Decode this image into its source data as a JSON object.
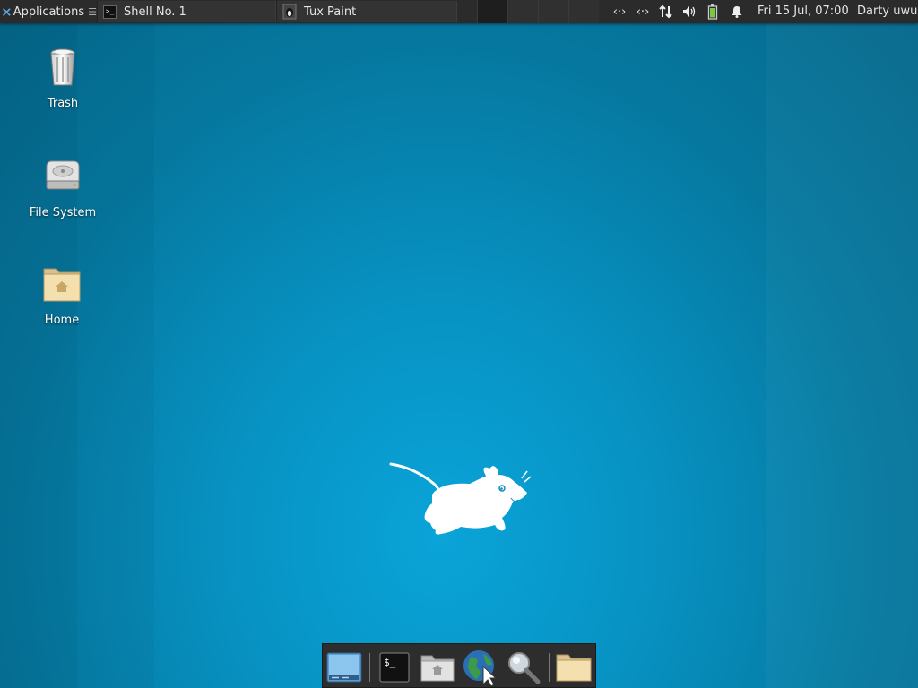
{
  "panel": {
    "applications_label": "Applications",
    "tasks": [
      {
        "label": "Shell No. 1",
        "icon": "terminal-icon"
      },
      {
        "label": "Tux Paint",
        "icon": "tux-paint-icon"
      }
    ],
    "clock": "Fri 15 Jul, 07:00",
    "user": "Darty uwu",
    "tray_icons": [
      "network-icon",
      "network-icon",
      "transfer-icon",
      "volume-icon",
      "battery-icon",
      "notification-bell-icon"
    ]
  },
  "desktop": {
    "icons": [
      {
        "label": "Trash",
        "icon": "trash-icon"
      },
      {
        "label": "File System",
        "icon": "drive-icon"
      },
      {
        "label": "Home",
        "icon": "home-folder-icon"
      }
    ]
  },
  "dock": {
    "items": [
      "show-desktop-icon",
      "terminal-icon",
      "home-folder-icon",
      "web-browser-icon",
      "search-icon",
      "folder-icon"
    ]
  },
  "colors": {
    "panel_bg": "#2b2b2b",
    "wallpaper_center": "#0aa4d8",
    "wallpaper_edge": "#05678a"
  }
}
